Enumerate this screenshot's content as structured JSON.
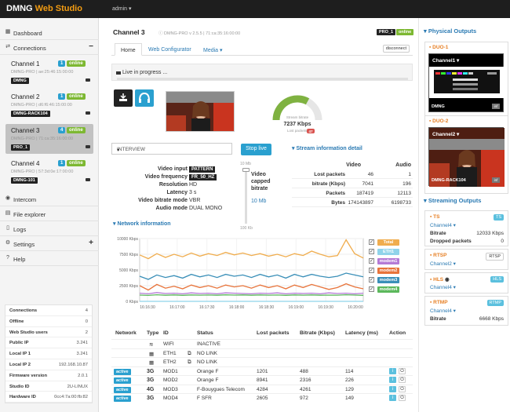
{
  "app": {
    "logo_text": "DMNG",
    "logo_accent": "Web Studio",
    "user": "admin ▾",
    "accent_color": "#f39c12"
  },
  "sidebar": {
    "dashboard": "Dashboard",
    "connections": "Connections",
    "channels": [
      {
        "name": "Channel 1",
        "count": "1",
        "status": "online",
        "sub": "DMNG-PRO | ae:25:46:15:00:00",
        "tag": "DMNG"
      },
      {
        "name": "Channel 2",
        "count": "1",
        "status": "online",
        "sub": "DMNG-PRO | d6:f6:46:15:00:00",
        "tag": "DMNG-RACK104"
      },
      {
        "name": "Channel 3",
        "count": "4",
        "status": "online",
        "sub": "DMNG-PRO | 71:ca:35:16:00:00",
        "tag": "PRO_1"
      },
      {
        "name": "Channel 4",
        "count": "1",
        "status": "online",
        "sub": "DMNG-PRO | 57:3d:0e:17:00:00",
        "tag": "DMNG-101"
      }
    ],
    "intercom": "Intercom",
    "file_explorer": "File explorer",
    "logs": "Logs",
    "settings": "Settings",
    "help": "Help"
  },
  "stats": [
    {
      "k": "Connections",
      "v": "4"
    },
    {
      "k": "Offline",
      "v": "0"
    },
    {
      "k": "Web Studio users",
      "v": "2"
    },
    {
      "k": "Public IP",
      "v": "3.241"
    },
    {
      "k": "Local IP 1",
      "v": "3.241"
    },
    {
      "k": "Local IP 2",
      "v": "192.168.10.87"
    },
    {
      "k": "Firmware version",
      "v": "2.0.1"
    },
    {
      "k": "Studio ID",
      "v": "2U-LINUX"
    },
    {
      "k": "Hardware ID",
      "v": "0cc4:7a:00:fb:82"
    }
  ],
  "channel": {
    "title": "Channel 3",
    "sub": "DMNG-PRO v 2.5.5  |  71:ca:35:16:00:00",
    "badge": "PRO_1",
    "status": "online",
    "tabs": [
      "Home",
      "Web Configurator",
      "Media ▾"
    ],
    "disconnect": "disconnect",
    "live_text": "Live in progress ...",
    "gauge_label": "Stream bitrate",
    "gauge_value": "7237 Kbps",
    "gauge_level": 0.66,
    "lost_packets_label": "Lost packets",
    "lost_packets": "47",
    "profile": "INTERVIEW",
    "stop_label": "Stop live"
  },
  "video": [
    {
      "k": "Video input",
      "v": "PATTERN",
      "tag": true
    },
    {
      "k": "Video frequency",
      "v": "FR_50_HZ",
      "tag": true
    },
    {
      "k": "Resolution",
      "v": "HD"
    },
    {
      "k": "Latency",
      "v": "3 s"
    },
    {
      "k": "Video bitrate mode",
      "v": "VBR"
    },
    {
      "k": "Audio mode",
      "v": "DUAL MONO"
    }
  ],
  "slider": {
    "top": "10 Mb",
    "bottom": "100 Kb",
    "label": "Video capped bitrate",
    "value": "10 Mb"
  },
  "stream_info": {
    "title": "Stream information detail",
    "cols": [
      "Video",
      "Audio"
    ],
    "rows": [
      {
        "k": "Lost packets",
        "a": "46",
        "b": "1"
      },
      {
        "k": "bitrate (Kbps)",
        "a": "7041",
        "b": "196"
      },
      {
        "k": "Packets",
        "a": "187419",
        "b": "12113"
      },
      {
        "k": "Bytes",
        "a": "174143897",
        "b": "6198733"
      }
    ]
  },
  "network_title": "Network information",
  "chart_data": {
    "type": "line",
    "y_ticks": [
      "10000 Kbps",
      "7500 Kbps",
      "5000 Kbps",
      "2500 Kbps",
      "0 Kbps"
    ],
    "ylim": [
      0,
      10000
    ],
    "x": [
      "16:16:30",
      "16:17:00",
      "16:17:30",
      "16:18:00",
      "16:18:30",
      "16:19:00",
      "16:19:30",
      "16:20:00"
    ],
    "series": [
      {
        "name": "Total",
        "color": "#f0ad4e",
        "values": [
          7400,
          6800,
          7600,
          7000,
          7500,
          7100,
          7700,
          7200,
          7600,
          7300,
          7800,
          7400,
          7700,
          7300,
          7600,
          7200,
          7500,
          7100,
          7600,
          7300,
          8000,
          7500,
          7100,
          7300,
          9800,
          7600,
          6900
        ]
      },
      {
        "name": "ETH1",
        "color": "#8fd3ea",
        "values": [
          0,
          0,
          0,
          0,
          0,
          0,
          0,
          0,
          0,
          0,
          0,
          0,
          0,
          0,
          0,
          0,
          0,
          0,
          0,
          0,
          0,
          0,
          0,
          0,
          0,
          0,
          0
        ]
      },
      {
        "name": "modem1",
        "color": "#b47ad6",
        "values": [
          1300,
          1200,
          1400,
          1250,
          1300,
          1200,
          1350,
          1250,
          1300,
          1200,
          1350,
          1300,
          1250,
          1200,
          1300,
          1250,
          1350,
          1200,
          1300,
          1250,
          1300,
          1200,
          1350,
          1250,
          1300,
          1200,
          1300
        ]
      },
      {
        "name": "modem2",
        "color": "#e8743b",
        "values": [
          2500,
          1800,
          2700,
          2100,
          2400,
          2000,
          2600,
          2200,
          2500,
          2100,
          2600,
          2300,
          2500,
          2100,
          2600,
          2200,
          2500,
          2000,
          2600,
          2200,
          2700,
          2300,
          1900,
          2200,
          2800,
          2300,
          2000
        ]
      },
      {
        "name": "modem3",
        "color": "#3a8fb8",
        "values": [
          4000,
          3500,
          4200,
          3800,
          4100,
          3700,
          4300,
          3900,
          4200,
          3800,
          4300,
          4000,
          4200,
          3800,
          4300,
          3900,
          4200,
          3700,
          4300,
          3900,
          4300,
          4000,
          3800,
          4000,
          4500,
          4200,
          3900
        ]
      },
      {
        "name": "modem4",
        "color": "#5cb85c",
        "values": [
          1000,
          950,
          1050,
          980,
          1020,
          960,
          1030,
          990,
          1010,
          970,
          1040,
          1000,
          1020,
          980,
          1030,
          990,
          1010,
          960,
          1030,
          990,
          1020,
          980,
          1000,
          990,
          1050,
          1000,
          960
        ]
      }
    ]
  },
  "net_table": {
    "headers": [
      "Network",
      "Type",
      "ID",
      "Status",
      "Lost packets",
      "Bitrate (Kbps)",
      "Latency (ms)",
      "Action"
    ],
    "rows": [
      {
        "active": "",
        "type": "wifi",
        "id": "WIFI",
        "status": "INACTIVE",
        "lost": "",
        "bitrate": "",
        "latency": "",
        "action": false
      },
      {
        "active": "",
        "type": "eth",
        "id": "ETH1",
        "status": "NO LINK",
        "lost": "",
        "bitrate": "",
        "latency": "",
        "action": false
      },
      {
        "active": "",
        "type": "eth",
        "id": "ETH2",
        "status": "NO LINK",
        "lost": "",
        "bitrate": "",
        "latency": "",
        "action": false
      },
      {
        "active": "active",
        "type": "3G",
        "id": "MOD1",
        "status": "Orange F",
        "lost": "1201",
        "bitrate": "488",
        "latency": "114",
        "action": true
      },
      {
        "active": "active",
        "type": "3G",
        "id": "MOD2",
        "status": "Orange F",
        "lost": "8941",
        "bitrate": "2316",
        "latency": "226",
        "action": true
      },
      {
        "active": "active",
        "type": "4G",
        "id": "MOD3",
        "status": "F-Bouygues Telecom",
        "lost": "4284",
        "bitrate": "4261",
        "latency": "129",
        "action": true
      },
      {
        "active": "active",
        "type": "3G",
        "id": "MOD4",
        "status": "F SFR",
        "lost": "2605",
        "bitrate": "972",
        "latency": "149",
        "action": true
      }
    ]
  },
  "physical_outputs": {
    "title": "Physical Outputs",
    "devices": [
      {
        "name": "DUO-1",
        "channel": "Channel1 ▾",
        "label": "DMNG"
      },
      {
        "name": "DUO-2",
        "channel": "Channel2 ▾",
        "label": "DMNG-RACK104"
      }
    ]
  },
  "streaming_outputs": {
    "title": "Streaming Outputs",
    "items": [
      {
        "name": "TS",
        "link": "Channel4 ▾",
        "button": "TS",
        "rows": [
          {
            "k": "Bitrate",
            "v": "12033 Kbps"
          },
          {
            "k": "Dropped packets",
            "v": "0"
          }
        ]
      },
      {
        "name": "RTSP",
        "link": "Channel2 ▾",
        "button": "RTSP",
        "rows": []
      },
      {
        "name": "HLS",
        "link": "Channel4 ▾",
        "button": "HLS",
        "rows": []
      },
      {
        "name": "RTMP",
        "link": "Channel4 ▾",
        "button": "RTMP",
        "rows": [
          {
            "k": "Bitrate",
            "v": "6668 Kbps"
          }
        ]
      }
    ]
  }
}
